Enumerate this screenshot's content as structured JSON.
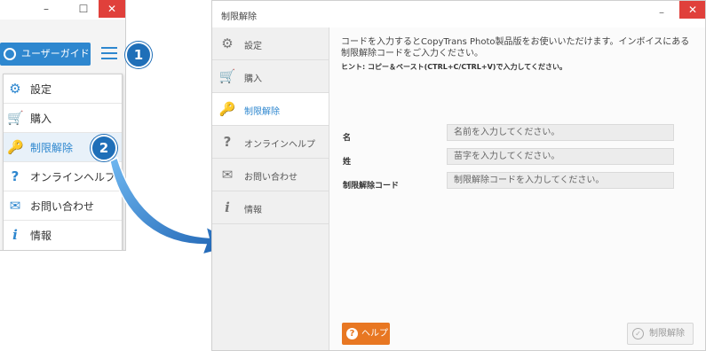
{
  "left_window": {
    "minimize": "–",
    "maximize": "☐",
    "close": "✕",
    "guide_button": "ユーザーガイド",
    "menu": [
      {
        "icon": "gear-icon",
        "glyph": "⚙",
        "label": "設定"
      },
      {
        "icon": "cart-icon",
        "glyph": "🛒",
        "label": "購入"
      },
      {
        "icon": "key-icon",
        "glyph": "🔑",
        "label": "制限解除",
        "active": true
      },
      {
        "icon": "question-icon",
        "glyph": "?",
        "label": "オンラインヘルプ"
      },
      {
        "icon": "envelope-icon",
        "glyph": "✉",
        "label": "お問い合わせ"
      },
      {
        "icon": "info-icon",
        "glyph": "i",
        "label": "情報"
      }
    ]
  },
  "badges": {
    "step1": "1",
    "step2": "2"
  },
  "dialog": {
    "title": "制限解除",
    "minimize": "–",
    "close": "✕",
    "sidebar": [
      {
        "icon": "gear-icon",
        "glyph": "⚙",
        "label": "設定"
      },
      {
        "icon": "cart-icon",
        "glyph": "🛒",
        "label": "購入"
      },
      {
        "icon": "key-icon",
        "glyph": "🔑",
        "label": "制限解除",
        "active": true
      },
      {
        "icon": "question-icon",
        "glyph": "?",
        "label": "オンラインヘルプ"
      },
      {
        "icon": "envelope-icon",
        "glyph": "✉",
        "label": "お問い合わせ"
      },
      {
        "icon": "info-icon",
        "glyph": "i",
        "label": "情報"
      }
    ],
    "description": "コードを入力するとCopyTrans Photo製品版をお使いいただけます。インボイスにある制限解除コードをご入力ください。",
    "hint": "ヒント: コピー＆ペースト(CTRL+C/CTRL+V)で入力してください。",
    "fields": [
      {
        "label": "名",
        "placeholder": "名前を入力してください。"
      },
      {
        "label": "姓",
        "placeholder": "苗字を入力してください。"
      },
      {
        "label": "制限解除コード",
        "placeholder": "制限解除コードを入力してください。"
      }
    ],
    "help_button": "ヘルプ",
    "unlock_button": "制限解除"
  },
  "colors": {
    "accent": "#2e87cf",
    "orange": "#e87722",
    "close_red": "#e0403b",
    "badge": "#1f6fb8"
  }
}
